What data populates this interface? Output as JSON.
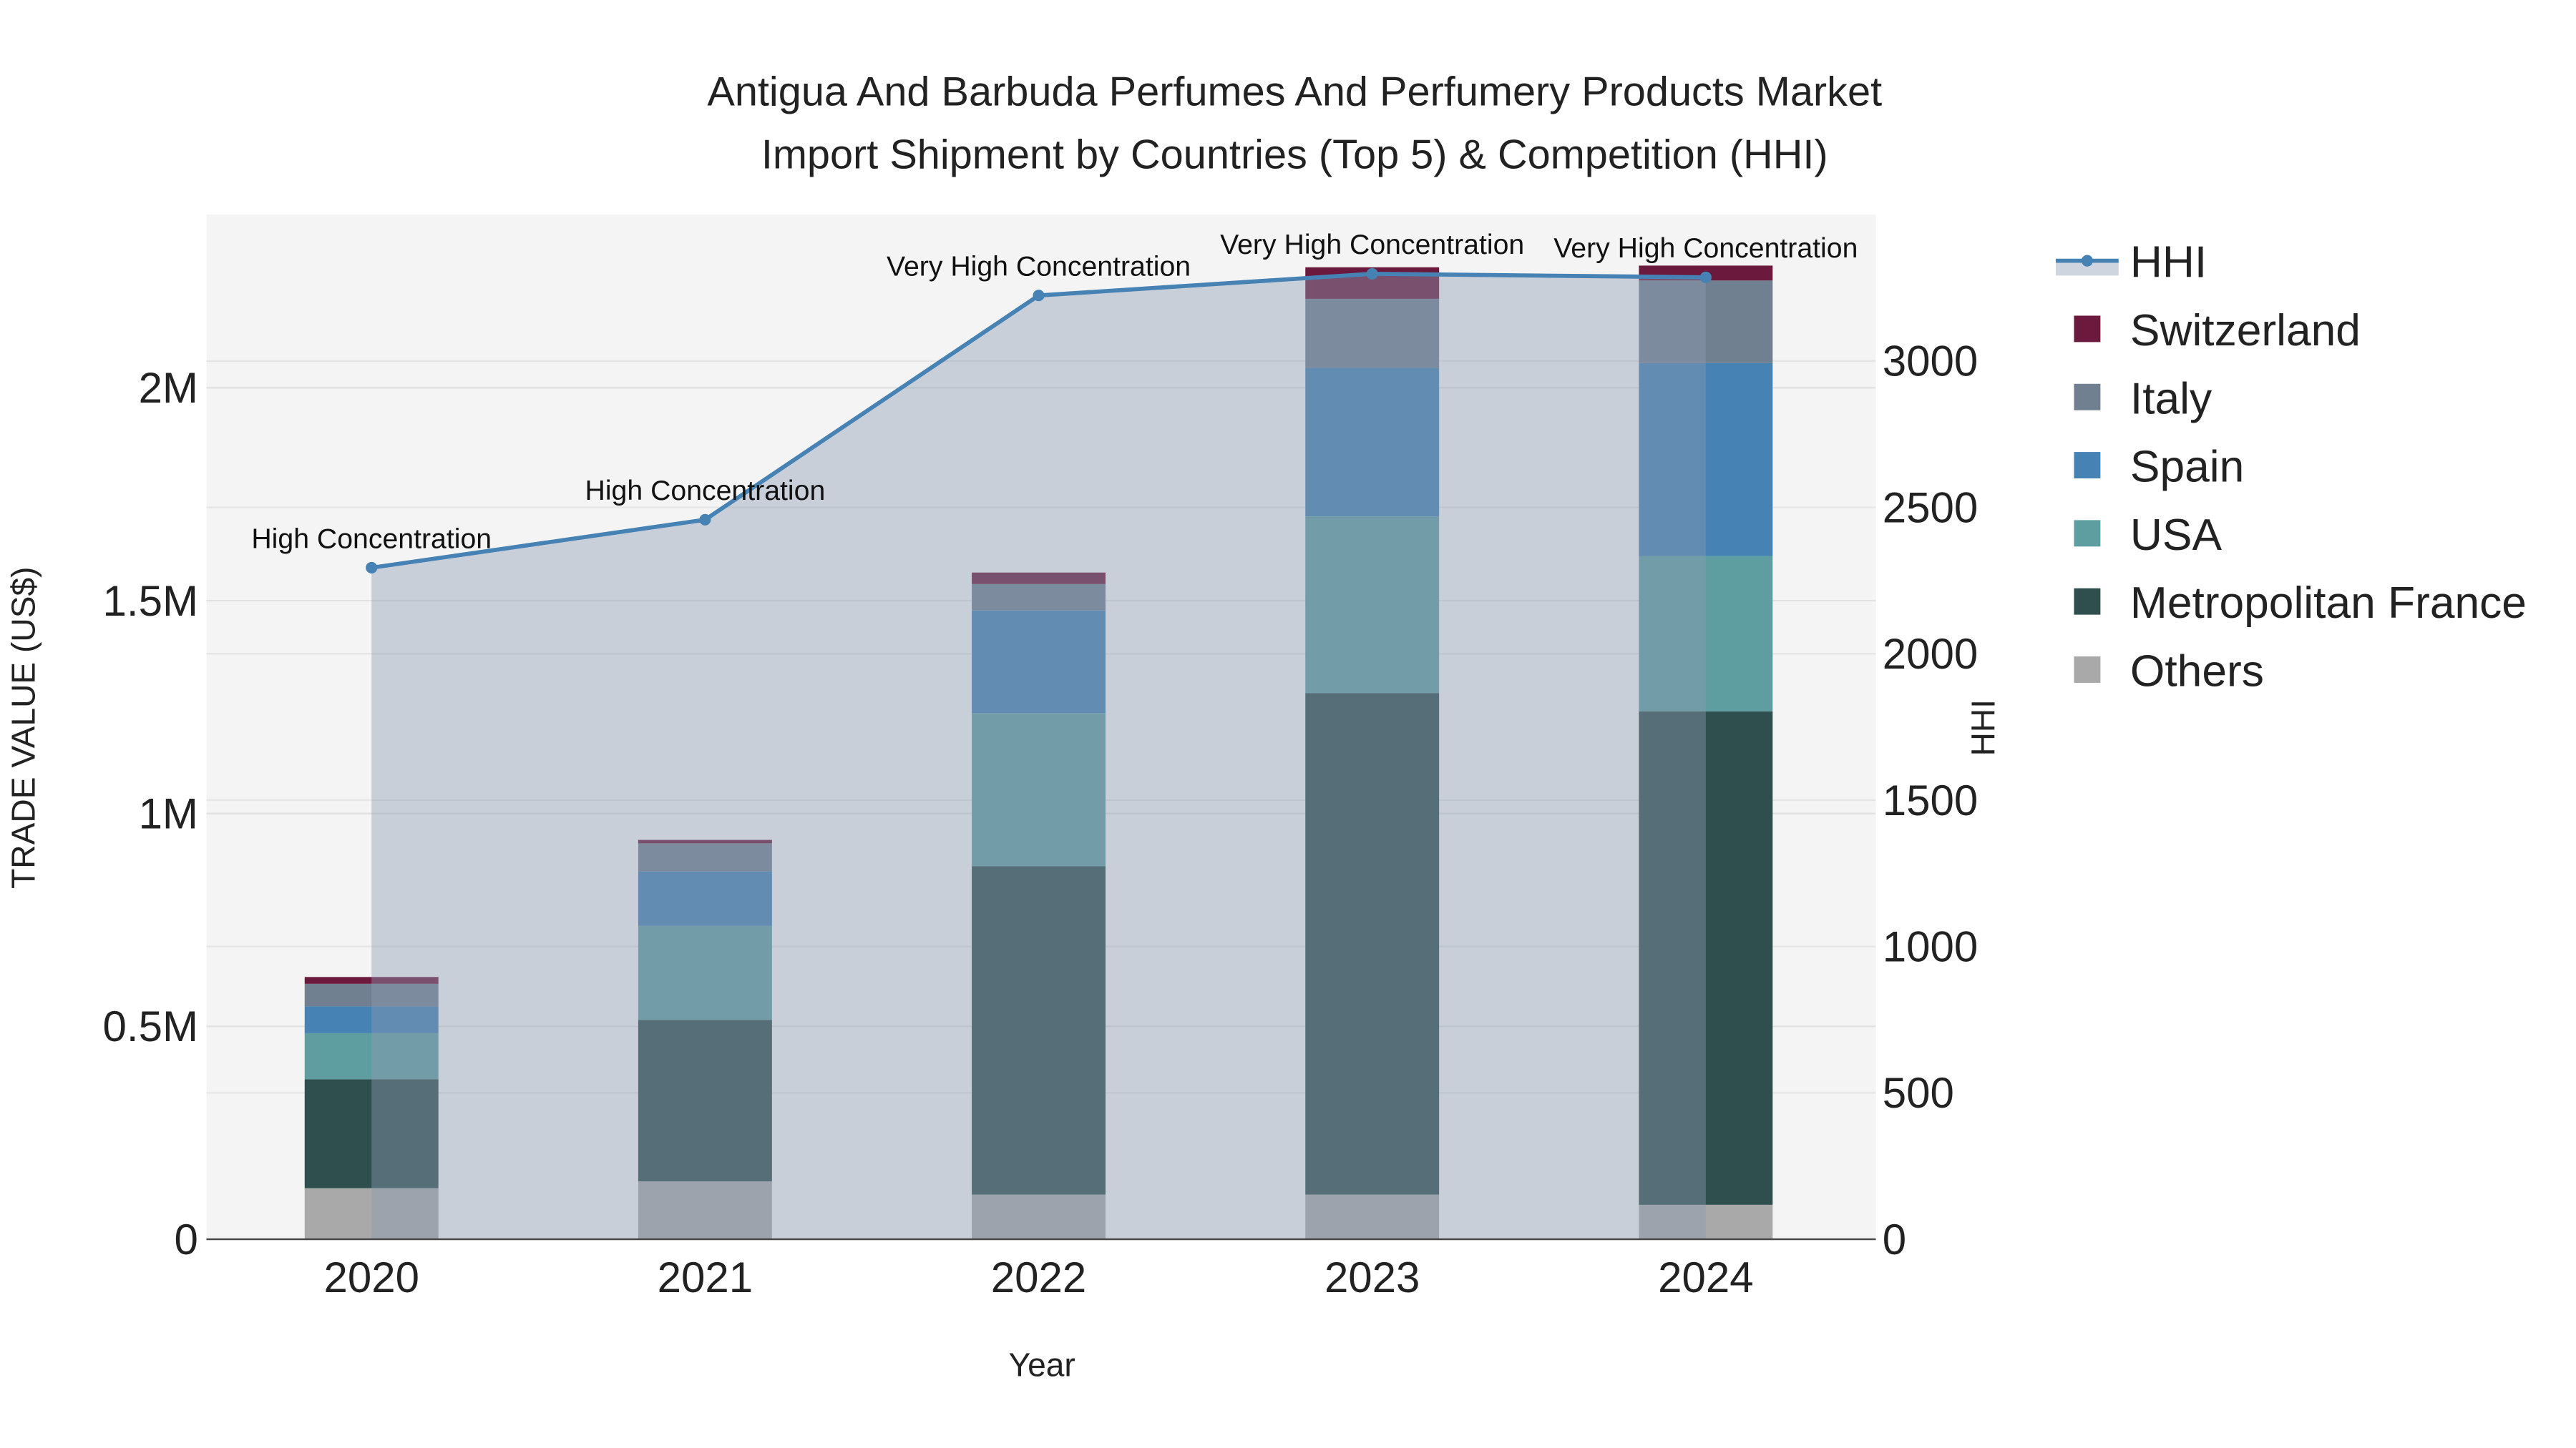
{
  "chart_data": {
    "type": "bar",
    "stacked": true,
    "title_line1": "Antigua And Barbuda Perfumes And Perfumery Products Market",
    "title_line2": "Import Shipment by Countries (Top 5) & Competition (HHI)",
    "xlabel": "Year",
    "ylabel": "TRADE VALUE (US$)",
    "y2label": "HHI",
    "categories": [
      "2020",
      "2021",
      "2022",
      "2023",
      "2024"
    ],
    "ylim": [
      0,
      2400000
    ],
    "y2lim": [
      0,
      3490
    ],
    "yticks": [
      {
        "v": 0,
        "label": "0"
      },
      {
        "v": 500000,
        "label": "0.5M"
      },
      {
        "v": 1000000,
        "label": "1M"
      },
      {
        "v": 1500000,
        "label": "1.5M"
      },
      {
        "v": 2000000,
        "label": "2M"
      }
    ],
    "y2ticks": [
      0,
      500,
      1000,
      1500,
      2000,
      2500,
      3000
    ],
    "series": [
      {
        "name": "Others",
        "color": "#a9a9a9",
        "values": [
          120000,
          136000,
          105000,
          105000,
          81000
        ]
      },
      {
        "name": "Metropolitan France",
        "color": "#2f4f4f",
        "values": [
          256000,
          379000,
          771000,
          1178000,
          1159000
        ]
      },
      {
        "name": "USA",
        "color": "#5f9ea0",
        "values": [
          108000,
          221000,
          360000,
          415000,
          365000
        ]
      },
      {
        "name": "Spain",
        "color": "#4682b4",
        "values": [
          63000,
          128000,
          241000,
          349000,
          453000
        ]
      },
      {
        "name": "Italy",
        "color": "#708090",
        "values": [
          53000,
          66000,
          62000,
          162000,
          194000
        ]
      },
      {
        "name": "Switzerland",
        "color": "#6b1a3d",
        "values": [
          16000,
          8000,
          27000,
          74000,
          35000
        ]
      }
    ],
    "hhi": {
      "name": "HHI",
      "color": "#4682b4",
      "values": [
        2294,
        2458,
        3224,
        3298,
        3286
      ],
      "annotations": [
        "High Concentration",
        "High Concentration",
        "Very High Concentration",
        "Very High Concentration",
        "Very High Concentration"
      ]
    },
    "legend_order": [
      "HHI",
      "Switzerland",
      "Italy",
      "Spain",
      "USA",
      "Metropolitan France",
      "Others"
    ],
    "legend_position": "right",
    "grid": true
  }
}
